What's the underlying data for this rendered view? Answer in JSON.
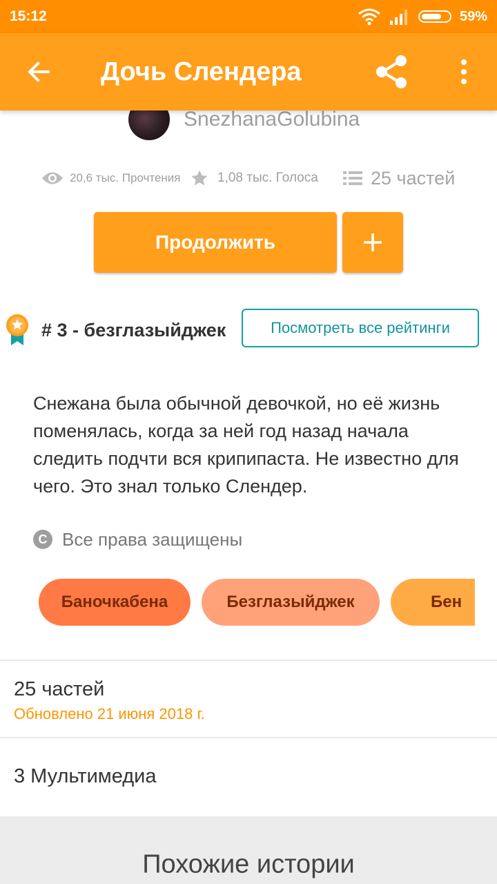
{
  "status_bar": {
    "time": "15:12",
    "battery_percent": "59%"
  },
  "app_bar": {
    "title": "Дочь Слендера",
    "back_icon": "arrow-left-icon",
    "share_icon": "share-icon",
    "more_icon": "more-vert-icon"
  },
  "author": {
    "name": "SnezhanaGolubina"
  },
  "stats": {
    "reads": "20,6 тыс. Прочтения",
    "votes": "1,08 тыс. Голоса",
    "parts": "25 частей"
  },
  "actions": {
    "continue_label": "Продолжить",
    "add_label": "+"
  },
  "ranking": {
    "text": "# 3 - безглазыйджек",
    "all_ratings_label": "Посмотреть все рейтинги"
  },
  "description": "Снежана была обычной девочкой, но её жизнь поменялась, когда за ней год назад начала следить подчти  вся крипипаста. Не известно для чего. Это знал только Слендер.",
  "copyright": {
    "symbol": "C",
    "text": "Все права защищены"
  },
  "tags": [
    {
      "label": "Баночкабена",
      "color": "#ff7a45"
    },
    {
      "label": "Безглазыйджек",
      "color": "#ffa27a"
    },
    {
      "label": "Бен",
      "color": "#ffab45"
    }
  ],
  "table_of_contents": {
    "parts_label": "25 частей",
    "updated_label": "Обновлено 21 июня 2018 г."
  },
  "media": {
    "label": "3 Мультимедиа"
  },
  "similar": {
    "title": "Похожие истории"
  },
  "colors": {
    "status_bar": "#ff8f00",
    "accent": "#ff9f1c",
    "teal": "#12a0a8",
    "updated_text": "#ff9500"
  }
}
